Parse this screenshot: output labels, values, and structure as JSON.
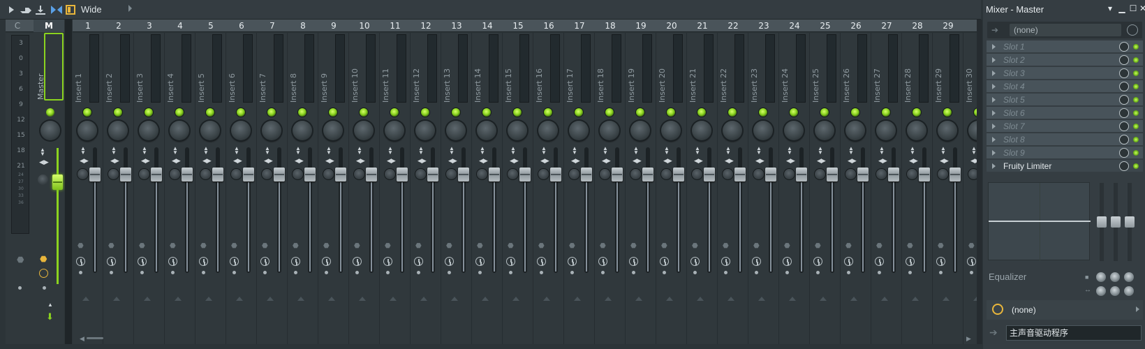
{
  "toolbar": {
    "view_label": "Wide"
  },
  "header": {
    "left_labels": [
      "C",
      "M"
    ],
    "insert_numbers": [
      "1",
      "2",
      "3",
      "4",
      "5",
      "6",
      "7",
      "8",
      "9",
      "10",
      "11",
      "12",
      "13",
      "14",
      "15",
      "16",
      "17",
      "18",
      "19",
      "20",
      "21",
      "22",
      "23",
      "24",
      "25",
      "26",
      "27",
      "28",
      "29"
    ]
  },
  "master": {
    "name": "Master",
    "db_scale": [
      "3",
      "0",
      "3",
      "6",
      "9",
      "12",
      "15",
      "18",
      "21",
      "24",
      "27",
      "30",
      "33",
      "36"
    ]
  },
  "inserts": [
    "Insert 1",
    "Insert 2",
    "Insert 3",
    "Insert 4",
    "Insert 5",
    "Insert 6",
    "Insert 7",
    "Insert 8",
    "Insert 9",
    "Insert 10",
    "Insert 11",
    "Insert 12",
    "Insert 13",
    "Insert 14",
    "Insert 15",
    "Insert 16",
    "Insert 17",
    "Insert 18",
    "Insert 19",
    "Insert 20",
    "Insert 21",
    "Insert 22",
    "Insert 23",
    "Insert 24",
    "Insert 25",
    "Insert 26",
    "Insert 27",
    "Insert 28",
    "Insert 29",
    "Insert 30"
  ],
  "panel": {
    "title": "Mixer - Master",
    "preset": "(none)",
    "slots": [
      "Slot 1",
      "Slot 2",
      "Slot 3",
      "Slot 4",
      "Slot 5",
      "Slot 6",
      "Slot 7",
      "Slot 8",
      "Slot 9",
      "Fruity Limiter"
    ],
    "eq_label": "Equalizer",
    "output": "(none)",
    "input": "主声音驱动程序"
  },
  "colors": {
    "accent_green": "#8bd31f",
    "background": "#2c3438",
    "panel": "#353d42"
  }
}
